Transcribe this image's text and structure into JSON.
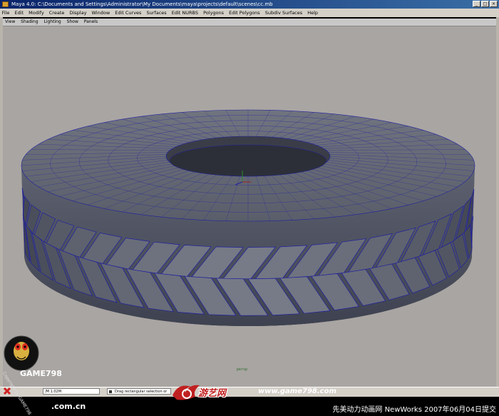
{
  "window": {
    "title": "Maya 4.0: C:\\Documents and Settings\\Administrator\\My Documents\\maya\\projects\\default\\scenes\\cc.mb"
  },
  "menubar": {
    "items": [
      "File",
      "Edit",
      "Modify",
      "Create",
      "Display",
      "Window",
      "Edit Curves",
      "Surfaces",
      "Edit NURBS",
      "Polygons",
      "Edit Polygons",
      "Subdiv Surfaces",
      "Help"
    ]
  },
  "panel_menu": {
    "items": [
      "View",
      "Shading",
      "Lighting",
      "Show",
      "Panels"
    ]
  },
  "viewport": {
    "camera_label": "persp",
    "background_color": "#a9a5a2",
    "mesh_color": "#565a66",
    "wire_color": "#2020a0"
  },
  "status": {
    "memory": "/M 1.02M",
    "help_text": "Drag rectangular selection or"
  },
  "watermark": {
    "site_short": "GAME798",
    "copyright": "Copyright by GAME798",
    "url_left": ".com.cn",
    "logo_cn": "游艺网",
    "logo_url": "www.game798.com",
    "submission": "先美动力动画网 NewWorks 2007年06月04日提交"
  }
}
